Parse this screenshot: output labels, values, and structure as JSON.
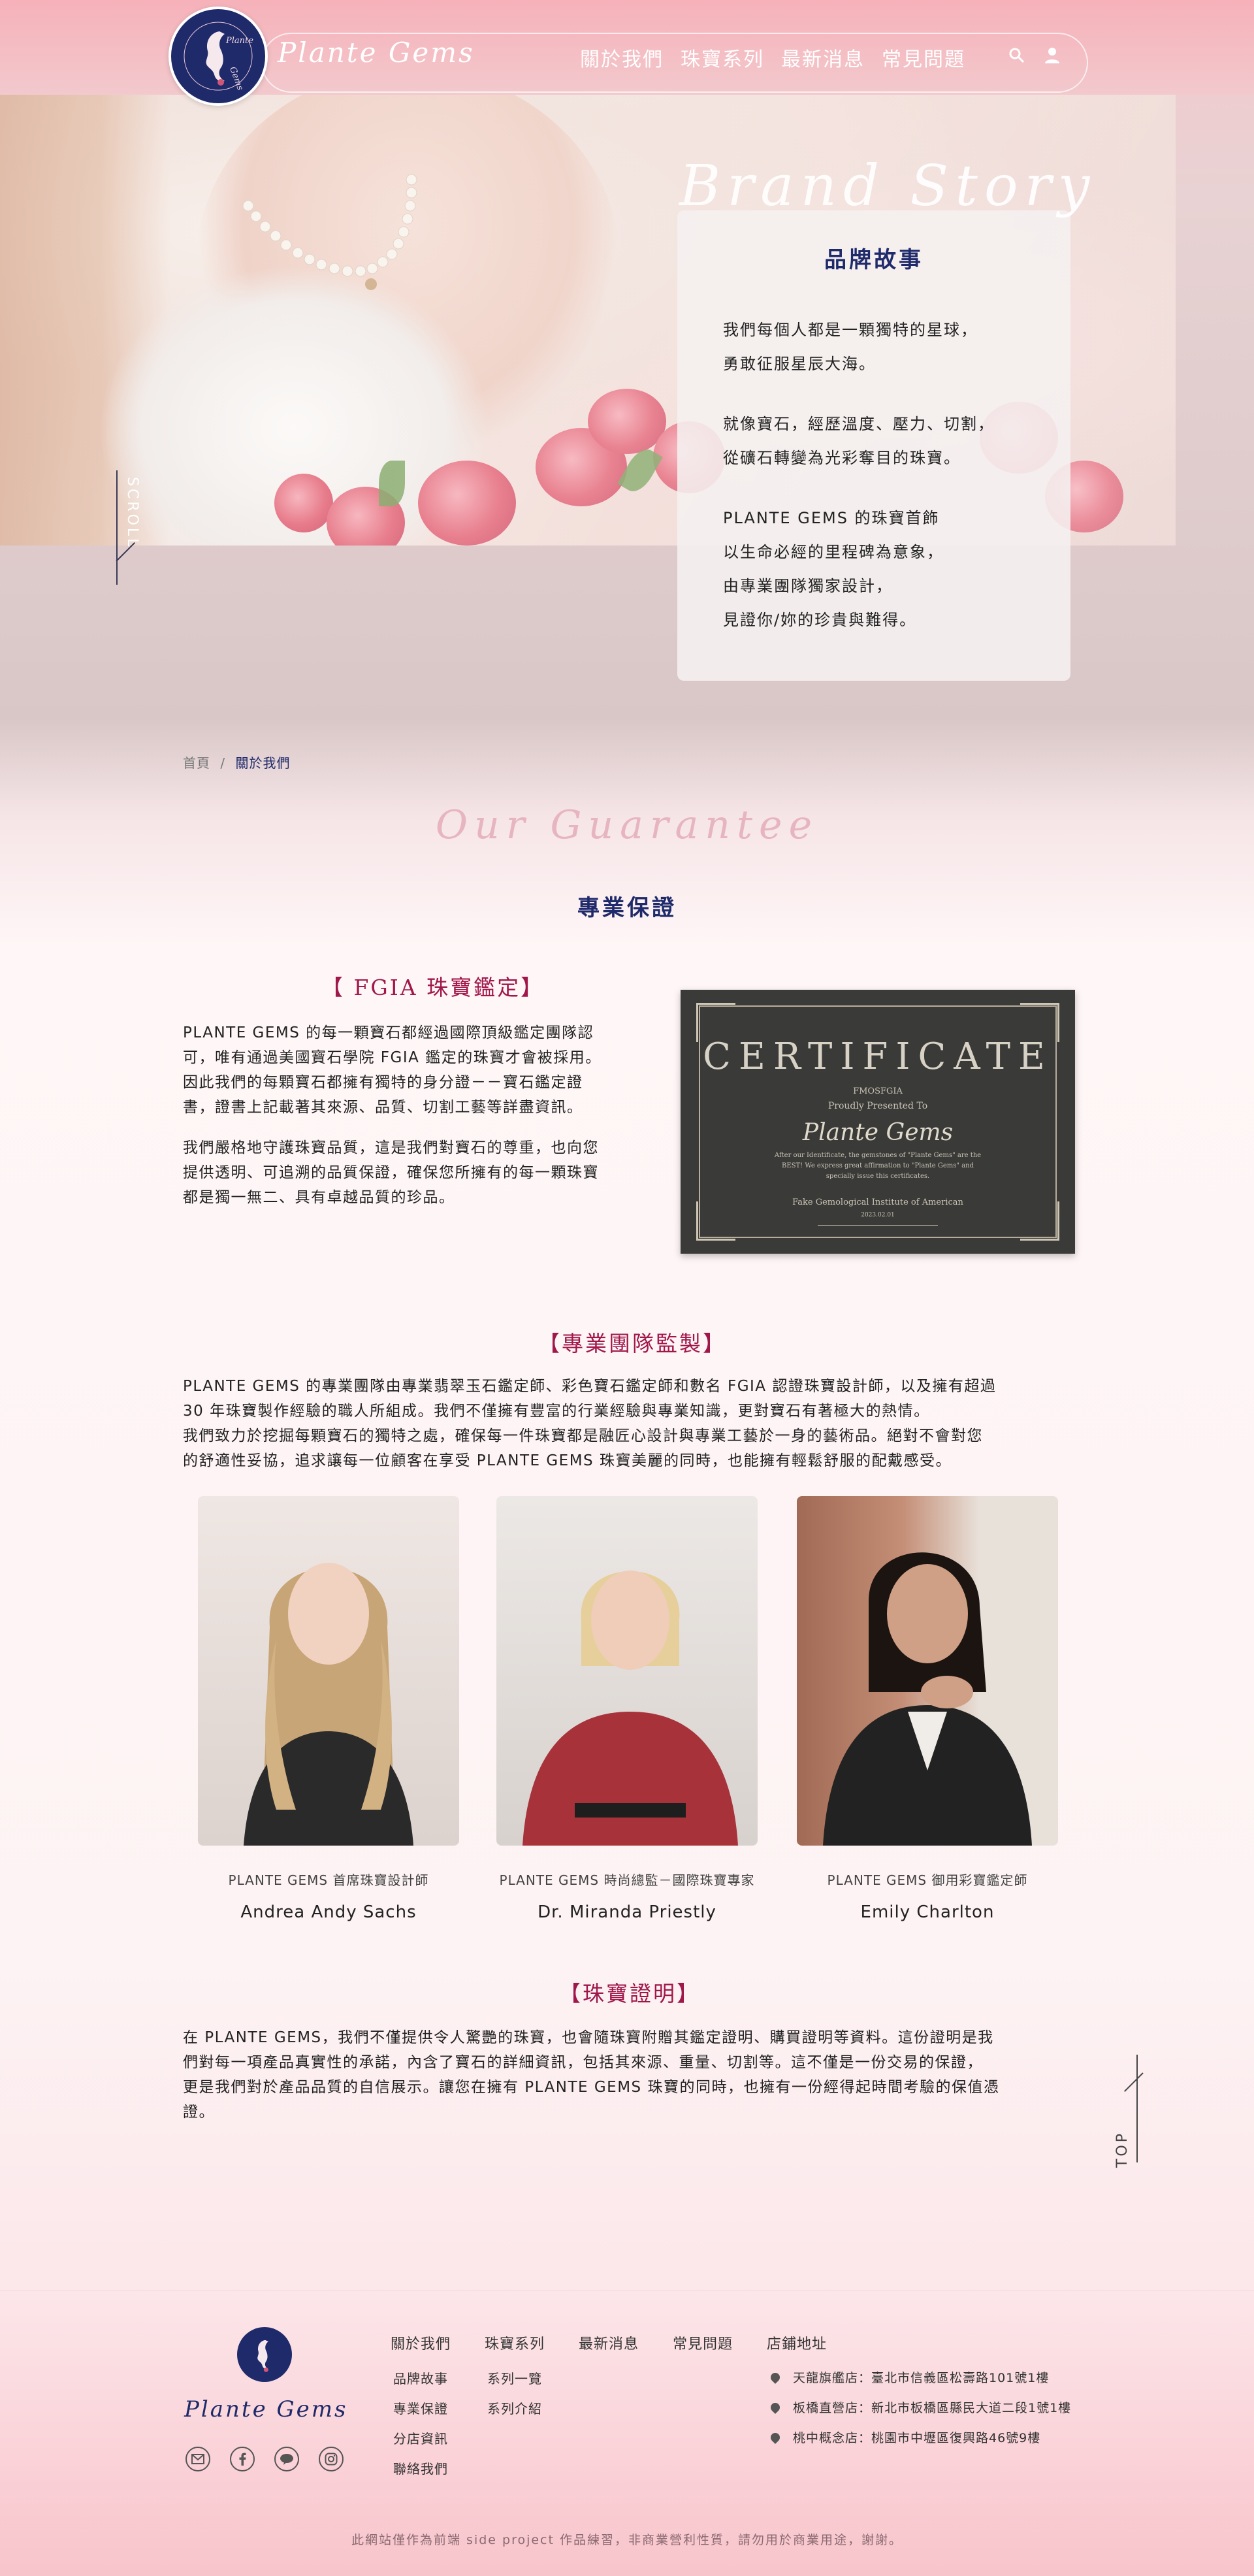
{
  "header": {
    "brand_name": "Plante Gems",
    "logo_text": "Plante Gems",
    "nav": [
      "關於我們",
      "珠寶系列",
      "最新消息",
      "常見問題"
    ]
  },
  "hero": {
    "scroll_label": "SCROLL"
  },
  "brand_story": {
    "title_en": "Brand Story",
    "title_zh": "品牌故事",
    "lines": [
      "我們每個人都是一顆獨特的星球，",
      "勇敢征服星辰大海。",
      "",
      "就像寶石，經歷溫度、壓力、切割，",
      "從礦石轉變為光彩奪目的珠寶。",
      "",
      "PLANTE GEMS 的珠寶首飾",
      "以生命必經的里程碑為意象，",
      "由專業團隊獨家設計，",
      "見證你/妳的珍貴與難得。"
    ]
  },
  "breadcrumb": {
    "home": "首頁",
    "separator": "/",
    "current": "關於我們"
  },
  "guarantee": {
    "title_en": "Our Guarantee",
    "title_zh": "專業保證",
    "fgia": {
      "heading": "【 FGIA 珠寶鑑定】",
      "para1_lines": [
        "PLANTE GEMS 的每一顆寶石都經過國際頂級鑑定團隊認",
        "可，唯有通過美國寶石學院 FGIA 鑑定的珠寶才會被採用。",
        "因此我們的每顆寶石都擁有獨特的身分證－－寶石鑑定證",
        "書，證書上記載著其來源、品質、切割工藝等詳盡資訊。"
      ],
      "para2_lines": [
        "我們嚴格地守護珠寶品質，這是我們對寶石的尊重，也向您",
        "提供透明、可追溯的品質保證，確保您所擁有的每一顆珠寶",
        "都是獨一無二、具有卓越品質的珍品。"
      ]
    },
    "certificate": {
      "title": "CERTIFICATE",
      "org_mark": "FMOSFGIA",
      "presented": "Proudly Presented To",
      "recipient": "Plante Gems",
      "body_lines": [
        "After our Identificate, the gemstones of \"Plante Gems\" are the",
        "BEST! We express great affirmation to \"Plante Gems\" and",
        "specially issue this certificates."
      ],
      "issuer": "Fake Gemological Institute of American",
      "date": "2023.02.01"
    },
    "team": {
      "heading": "【專業團隊監製】",
      "lines": [
        "PLANTE GEMS 的專業團隊由專業翡翠玉石鑑定師、彩色寶石鑑定師和數名 FGIA 認證珠寶設計師，以及擁有超過",
        "30 年珠寶製作經驗的職人所組成。我們不僅擁有豐富的行業經驗與專業知識，更對寶石有著極大的熱情。",
        "我們致力於挖掘每顆寶石的獨特之處，確保每一件珠寶都是融匠心設計與專業工藝於一身的藝術品。絕對不會對您",
        "的舒適性妥協，追求讓每一位顧客在享受 PLANTE GEMS 珠寶美麗的同時，也能擁有輕鬆舒服的配戴感受。"
      ],
      "members": [
        {
          "role": "PLANTE GEMS 首席珠寶設計師",
          "name": "Andrea Andy Sachs"
        },
        {
          "role": "PLANTE GEMS 時尚總監－國際珠寶專家",
          "name": "Dr. Miranda Priestly"
        },
        {
          "role": "PLANTE GEMS 御用彩寶鑑定師",
          "name": "Emily Charlton"
        }
      ]
    },
    "proof": {
      "heading": "【珠寶證明】",
      "lines": [
        "在 PLANTE GEMS，我們不僅提供令人驚艷的珠寶，也會隨珠寶附贈其鑑定證明、購買證明等資料。這份證明是我",
        "們對每一項產品真實性的承諾，內含了寶石的詳細資訊，包括其來源、重量、切割等。這不僅是一份交易的保證，",
        "更是我們對於產品品質的自信展示。讓您在擁有 PLANTE GEMS 珠寶的同時，也擁有一份經得起時間考驗的保值憑",
        "證。"
      ]
    }
  },
  "top_label": "TOP",
  "footer": {
    "brand": "Plante Gems",
    "logo_text": "Plante Gems",
    "col_titles": [
      "關於我們",
      "珠寶系列",
      "最新消息",
      "常見問題",
      "店鋪地址"
    ],
    "about_links": [
      "品牌故事",
      "專業保證",
      "分店資訊",
      "聯絡我們"
    ],
    "series_links": [
      "系列一覽",
      "系列介紹"
    ],
    "stores": [
      "天龍旗艦店：臺北市信義區松壽路101號1樓",
      "板橋直營店：新北市板橋區縣民大道二段1號1樓",
      "桃中概念店：桃園市中壢區復興路46號9樓"
    ],
    "copyright": "此網站僅作為前端 side project 作品練習，非商業營利性質，請勿用於商業用途，謝謝。"
  },
  "colors": {
    "navy": "#1f2a6b",
    "accent_red": "#a0174a",
    "pink_title": "#e6b5c0"
  }
}
